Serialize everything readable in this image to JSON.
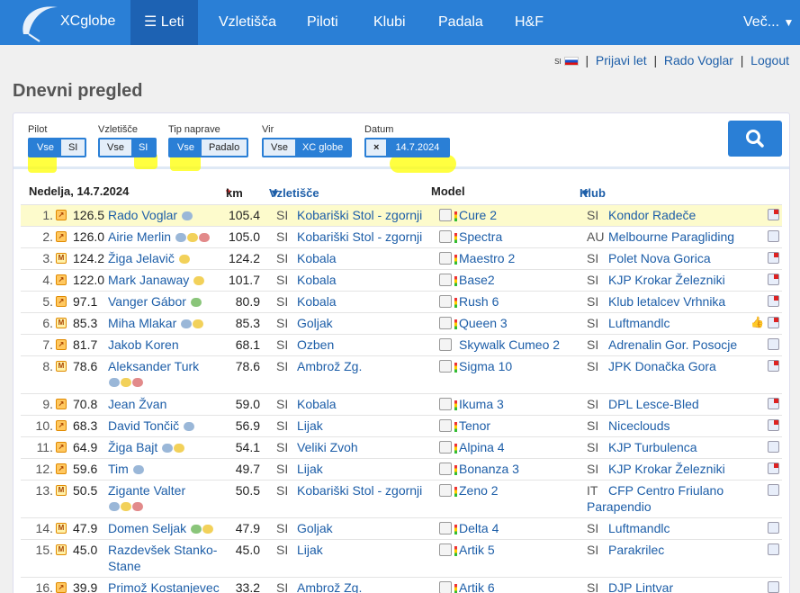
{
  "nav": {
    "brand": "XCglobe",
    "items": [
      "Leti",
      "Vzletišča",
      "Piloti",
      "Klubi",
      "Padala",
      "H&F"
    ],
    "more": "Več..."
  },
  "userbar": {
    "lang": "SI",
    "report_flight": "Prijavi let",
    "user": "Rado Voglar",
    "logout": "Logout"
  },
  "page_title": "Dnevni pregled",
  "filters": {
    "pilot": {
      "label": "Pilot",
      "options": [
        "Vse",
        "SI"
      ],
      "selected": "Vse"
    },
    "site": {
      "label": "Vzletišče",
      "options": [
        "Vse",
        "SI"
      ],
      "selected": "SI"
    },
    "type": {
      "label": "Tip naprave",
      "options": [
        "Vse",
        "Padalo"
      ],
      "selected": "Vse"
    },
    "source": {
      "label": "Vir",
      "options": [
        "Vse",
        "XC globe"
      ],
      "selected": "XC globe"
    },
    "date": {
      "label": "Datum",
      "clear": "×",
      "value": "14.7.2024"
    }
  },
  "table": {
    "date_header": "Nedelja, 14.7.2024",
    "km_star": "*",
    "km_header": "km",
    "site_header": "Vzletišče",
    "model_header": "Model",
    "club_header": "Klub",
    "rows": [
      {
        "rank": "1.",
        "score": "126.5",
        "pilot": "Rado Voglar",
        "km": "105.4",
        "site_cty": "SI",
        "site": "Kobariški Stol - zgornji",
        "model": "Cure 2",
        "club_cty": "SI",
        "club": "Kondor Radeče"
      },
      {
        "rank": "2.",
        "score": "126.0",
        "pilot": "Airie Merlin",
        "km": "105.0",
        "site_cty": "SI",
        "site": "Kobariški Stol - zgornji",
        "model": "Spectra",
        "club_cty": "AU",
        "club": "Melbourne Paragliding"
      },
      {
        "rank": "3.",
        "score": "124.2",
        "pilot": "Žiga Jelavič",
        "km": "124.2",
        "site_cty": "SI",
        "site": "Kobala",
        "model": "Maestro 2",
        "club_cty": "SI",
        "club": "Polet Nova Gorica"
      },
      {
        "rank": "4.",
        "score": "122.0",
        "pilot": "Mark Janaway",
        "km": "101.7",
        "site_cty": "SI",
        "site": "Kobala",
        "model": "Base2",
        "club_cty": "SI",
        "club": "KJP Krokar Železniki"
      },
      {
        "rank": "5.",
        "score": "97.1",
        "pilot": "Vanger Gábor",
        "km": "80.9",
        "site_cty": "SI",
        "site": "Kobala",
        "model": "Rush 6",
        "club_cty": "SI",
        "club": "Klub letalcev Vrhnika"
      },
      {
        "rank": "6.",
        "score": "85.3",
        "pilot": "Miha Mlakar",
        "km": "85.3",
        "site_cty": "SI",
        "site": "Goljak",
        "model": "Queen 3",
        "club_cty": "SI",
        "club": "Luftmandlc"
      },
      {
        "rank": "7.",
        "score": "81.7",
        "pilot": "Jakob Koren",
        "km": "68.1",
        "site_cty": "SI",
        "site": "Ozben",
        "model": "Skywalk Cumeo 2",
        "club_cty": "SI",
        "club": "Adrenalin Gor. Posocje"
      },
      {
        "rank": "8.",
        "score": "78.6",
        "pilot": "Aleksander Turk",
        "km": "78.6",
        "site_cty": "SI",
        "site": "Ambrož Zg.",
        "model": "Sigma 10",
        "club_cty": "SI",
        "club": "JPK Donačka Gora"
      },
      {
        "rank": "9.",
        "score": "70.8",
        "pilot": "Jean Žvan",
        "km": "59.0",
        "site_cty": "SI",
        "site": "Kobala",
        "model": "Ikuma 3",
        "club_cty": "SI",
        "club": "DPL Lesce-Bled"
      },
      {
        "rank": "10.",
        "score": "68.3",
        "pilot": "David Tončič",
        "km": "56.9",
        "site_cty": "SI",
        "site": "Lijak",
        "model": "Tenor",
        "club_cty": "SI",
        "club": "Niceclouds"
      },
      {
        "rank": "11.",
        "score": "64.9",
        "pilot": "Žiga Bajt",
        "km": "54.1",
        "site_cty": "SI",
        "site": "Veliki Zvoh",
        "model": "Alpina 4",
        "club_cty": "SI",
        "club": "KJP Turbulenca"
      },
      {
        "rank": "12.",
        "score": "59.6",
        "pilot": "Tim",
        "km": "49.7",
        "site_cty": "SI",
        "site": "Lijak",
        "model": "Bonanza 3",
        "club_cty": "SI",
        "club": "KJP Krokar Železniki"
      },
      {
        "rank": "13.",
        "score": "50.5",
        "pilot": "Zigante Valter",
        "km": "50.5",
        "site_cty": "SI",
        "site": "Kobariški Stol - zgornji",
        "model": "Zeno 2",
        "club_cty": "IT",
        "club": "CFP Centro Friulano",
        "club2": "Parapendio"
      },
      {
        "rank": "14.",
        "score": "47.9",
        "pilot": "Domen Seljak",
        "km": "47.9",
        "site_cty": "SI",
        "site": "Goljak",
        "model": "Delta 4",
        "club_cty": "SI",
        "club": "Luftmandlc"
      },
      {
        "rank": "15.",
        "score": "45.0",
        "pilot": "Razdevšek Stanko-",
        "pilot2": "Stane",
        "km": "45.0",
        "site_cty": "SI",
        "site": "Lijak",
        "model": "Artik 5",
        "club_cty": "SI",
        "club": "Parakrilec"
      },
      {
        "rank": "16.",
        "score": "39.9",
        "pilot": "Primož Kostanjevec",
        "km": "33.2",
        "site_cty": "SI",
        "site": "Ambrož Zg.",
        "model": "Artik 6",
        "club_cty": "SI",
        "club": "DJP Lintvar"
      }
    ]
  }
}
